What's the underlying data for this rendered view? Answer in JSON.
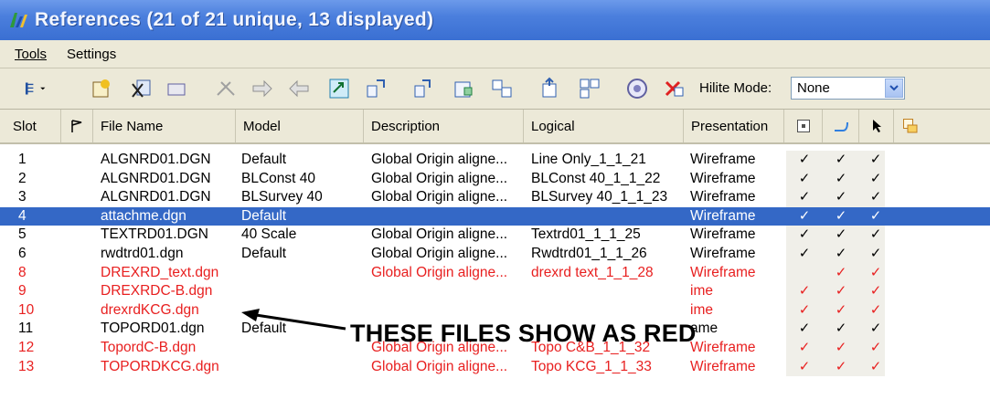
{
  "window": {
    "title": "References (21 of 21 unique, 13 displayed)"
  },
  "menu": [
    "Tools",
    "Settings"
  ],
  "toolbar": {
    "icons": [
      "list-view-icon",
      "attach-icon",
      "detach-icon",
      "reload-icon",
      "exchange-icon",
      "move-right-icon",
      "move-left-icon",
      "scale-icon",
      "rotate-icon",
      "mirror-icon",
      "clip-icon",
      "copy-icon",
      "merge-icon",
      "level-icon",
      "info-icon",
      "delete-icon"
    ],
    "hilite_label": "Hilite Mode:",
    "hilite_value": "None"
  },
  "columns": [
    "Slot",
    "File Name",
    "Model",
    "Description",
    "Logical",
    "Presentation"
  ],
  "colors": {
    "title_bar": "#3a6fd2",
    "selection": "#3468c6",
    "red_text": "#e82020",
    "chrome": "#ece9d8"
  },
  "rows": [
    {
      "slot": "1",
      "file": "ALGNRD01.DGN",
      "model": "Default",
      "desc": "Global Origin aligne...",
      "logical": "Line Only_1_1_21",
      "pres": "Wireframe",
      "checks": [
        "✓",
        "✓",
        "✓"
      ],
      "style": "normal"
    },
    {
      "slot": "2",
      "file": "ALGNRD01.DGN",
      "model": "BLConst 40",
      "desc": "Global Origin aligne...",
      "logical": "BLConst 40_1_1_22",
      "pres": "Wireframe",
      "checks": [
        "✓",
        "✓",
        "✓"
      ],
      "style": "normal"
    },
    {
      "slot": "3",
      "file": "ALGNRD01.DGN",
      "model": "BLSurvey 40",
      "desc": "Global Origin aligne...",
      "logical": "BLSurvey 40_1_1_23",
      "pres": "Wireframe",
      "checks": [
        "✓",
        "✓",
        "✓"
      ],
      "style": "normal"
    },
    {
      "slot": "4",
      "file": "attachme.dgn",
      "model": "Default",
      "desc": "",
      "logical": "",
      "pres": "Wireframe",
      "checks": [
        "✓",
        "✓",
        "✓"
      ],
      "style": "sel"
    },
    {
      "slot": "5",
      "file": "TEXTRD01.DGN",
      "model": "40 Scale",
      "desc": "Global Origin aligne...",
      "logical": "Textrd01_1_1_25",
      "pres": "Wireframe",
      "checks": [
        "✓",
        "✓",
        "✓"
      ],
      "style": "normal"
    },
    {
      "slot": "6",
      "file": "rwdtrd01.dgn",
      "model": "Default",
      "desc": "Global Origin aligne...",
      "logical": "Rwdtrd01_1_1_26",
      "pres": "Wireframe",
      "checks": [
        "✓",
        "✓",
        "✓"
      ],
      "style": "normal"
    },
    {
      "slot": "8",
      "file": "DREXRD_text.dgn",
      "model": "",
      "desc": "Global Origin aligne...",
      "logical": "drexrd text_1_1_28",
      "pres": "Wireframe",
      "checks": [
        "",
        "✓",
        "✓"
      ],
      "style": "red"
    },
    {
      "slot": "9",
      "file": "DREXRDC-B.dgn",
      "model": "",
      "desc": "",
      "logical": "",
      "pres": "ime",
      "checks": [
        "✓",
        "✓",
        "✓"
      ],
      "style": "red"
    },
    {
      "slot": "10",
      "file": "drexrdKCG.dgn",
      "model": "",
      "desc": "",
      "logical": "",
      "pres": "ime",
      "checks": [
        "✓",
        "✓",
        "✓"
      ],
      "style": "red"
    },
    {
      "slot": "11",
      "file": "TOPORD01.dgn",
      "model": "Default",
      "desc": "",
      "logical": "",
      "pres": "ame",
      "checks": [
        "✓",
        "✓",
        "✓"
      ],
      "style": "normal"
    },
    {
      "slot": "12",
      "file": "TopordC-B.dgn",
      "model": "",
      "desc": "Global Origin aligne...",
      "logical": "Topo C&B_1_1_32",
      "pres": "Wireframe",
      "checks": [
        "✓",
        "✓",
        "✓"
      ],
      "style": "red"
    },
    {
      "slot": "13",
      "file": "TOPORDKCG.dgn",
      "model": "",
      "desc": "Global Origin aligne...",
      "logical": "Topo KCG_1_1_33",
      "pres": "Wireframe",
      "checks": [
        "✓",
        "✓",
        "✓"
      ],
      "style": "red"
    }
  ],
  "annotation": "THESE FILES SHOW AS RED"
}
